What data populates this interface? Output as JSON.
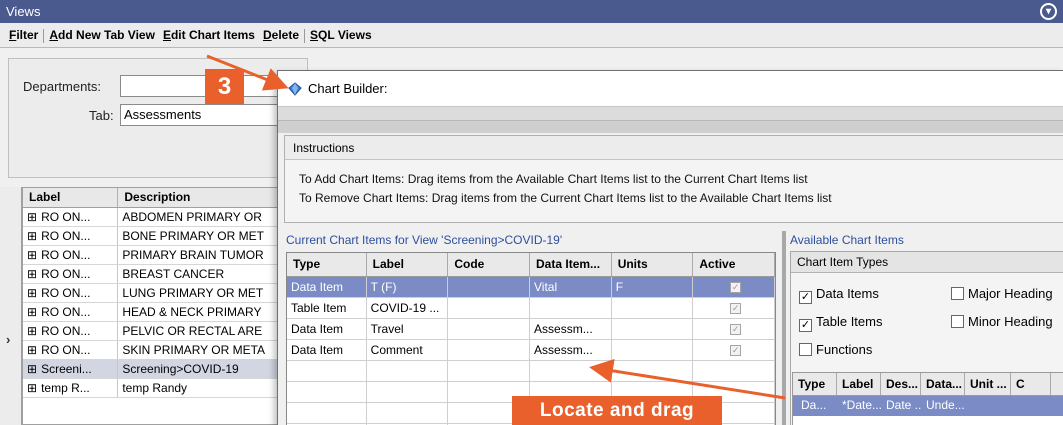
{
  "window": {
    "title": "Views",
    "collapse_icon": "chevron-down-circle-icon"
  },
  "menubar": {
    "items": [
      {
        "label": "Filter",
        "ul": "F",
        "rest": "ilter"
      },
      {
        "label": "Add New Tab View",
        "ul": "A",
        "rest": "dd New Tab View"
      },
      {
        "label": "Edit Chart Items",
        "ul": "E",
        "rest": "dit Chart Items"
      },
      {
        "label": "Delete",
        "ul": "D",
        "rest": "elete"
      },
      {
        "label": "SQL Views",
        "ul": "S",
        "rest": "QL Views"
      }
    ]
  },
  "filter": {
    "departments_label": "Departments:",
    "departments_value": "",
    "tab_label": "Tab:",
    "tab_value": "Assessments"
  },
  "views_table": {
    "columns": [
      "Label",
      "Description"
    ],
    "rows": [
      {
        "label": "RO ON...",
        "description": "ABDOMEN PRIMARY OR"
      },
      {
        "label": "RO ON...",
        "description": "BONE PRIMARY OR MET"
      },
      {
        "label": "RO ON...",
        "description": "PRIMARY BRAIN TUMOR"
      },
      {
        "label": "RO ON...",
        "description": "BREAST CANCER"
      },
      {
        "label": "RO ON...",
        "description": "LUNG PRIMARY OR MET"
      },
      {
        "label": "RO ON...",
        "description": "HEAD & NECK PRIMARY"
      },
      {
        "label": "RO ON...",
        "description": "PELVIC OR RECTAL ARE"
      },
      {
        "label": "RO ON...",
        "description": "SKIN PRIMARY OR META"
      },
      {
        "label": "Screeni...",
        "description": "Screening>COVID-19"
      },
      {
        "label": "temp R...",
        "description": "temp Randy"
      }
    ],
    "selected_index": 8,
    "expand_glyph": "⊞",
    "row_marker": "›"
  },
  "chart_builder": {
    "title": "Chart Builder:",
    "app_icon": "blue-gem-icon",
    "instructions_title": "Instructions",
    "instructions": [
      "To Add Chart Items:  Drag items from the Available Chart Items list to the Current Chart Items list",
      "To Remove Chart Items:  Drag items from the Current Chart Items list to the Available Chart Items list"
    ],
    "current_title": "Current Chart Items for View 'Screening>COVID-19'",
    "current_columns": [
      "Type",
      "Label",
      "Code",
      "Data Item...",
      "Units",
      "Active"
    ],
    "current_rows": [
      {
        "type": "Data Item",
        "label": "T (F)",
        "code": "",
        "data_item": "Vital",
        "units": "F",
        "active": true
      },
      {
        "type": "Table Item",
        "label": "COVID-19 ...",
        "code": "",
        "data_item": "",
        "units": "",
        "active": true
      },
      {
        "type": "Data Item",
        "label": "Travel",
        "code": "",
        "data_item": "Assessm...",
        "units": "",
        "active": true
      },
      {
        "type": "Data Item",
        "label": "Comment",
        "code": "",
        "data_item": "Assessm...",
        "units": "",
        "active": true
      }
    ],
    "current_selected_index": 0,
    "available_title": "Available Chart Items",
    "item_types_title": "Chart Item Types",
    "item_types": [
      {
        "label": "Data Items",
        "checked": true
      },
      {
        "label": "Major Heading",
        "checked": false
      },
      {
        "label": "Table Items",
        "checked": true
      },
      {
        "label": "Minor Heading",
        "checked": false
      },
      {
        "label": "Functions",
        "checked": false
      }
    ],
    "available_columns": [
      "Type",
      "Label",
      "Des...",
      "Data...",
      "Unit ...",
      "C"
    ],
    "available_rows": [
      {
        "type": "Da...",
        "label": "*Date...",
        "desc": "Date ...",
        "data": "Unde...",
        "unit": "",
        "c": ""
      }
    ]
  },
  "callouts": {
    "step_number": "3",
    "hint": "Locate and drag"
  },
  "colors": {
    "titlebar": "#4a5a8e",
    "selection": "#7b8bc6",
    "callout": "#e9602c",
    "link_blue": "#2d4f9e"
  }
}
